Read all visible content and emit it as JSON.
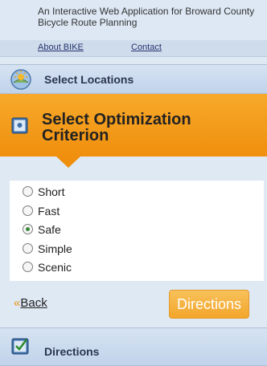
{
  "header": {
    "tagline": "An Interactive Web Application for Broward County Bicycle Route Planning"
  },
  "nav": {
    "links": [
      {
        "label": "About BIKE"
      },
      {
        "label": "Contact"
      }
    ]
  },
  "sections": {
    "select_locations": {
      "label": "Select Locations",
      "icon": "sun-map-icon"
    },
    "criterion": {
      "label": "Select Optimization Criterion",
      "icon": "map-pin-icon"
    },
    "directions": {
      "label": "Directions",
      "icon": "map-check-icon"
    }
  },
  "options": [
    {
      "label": "Short",
      "selected": false
    },
    {
      "label": "Fast",
      "selected": false
    },
    {
      "label": "Safe",
      "selected": true
    },
    {
      "label": "Simple",
      "selected": false
    },
    {
      "label": "Scenic",
      "selected": false
    }
  ],
  "actions": {
    "back_chevron": "«",
    "back_label": "Back",
    "directions_button": "Directions"
  },
  "colors": {
    "accent_orange": "#f08f0d",
    "band_blue": "#c1d3ea",
    "button_orange": "#f3a62b"
  }
}
